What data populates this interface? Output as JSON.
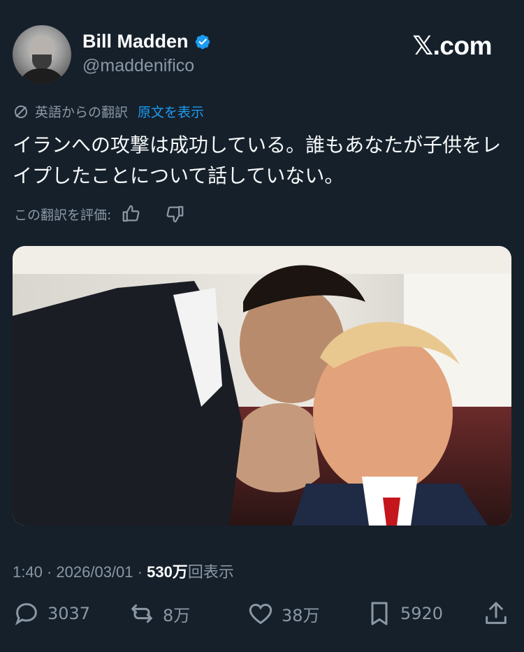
{
  "author": {
    "name": "Bill Madden",
    "handle": "@maddenifico",
    "verified": true,
    "avatar_icon": "profile-photo"
  },
  "brand": {
    "prefix": "𝕏",
    "suffix": ".com"
  },
  "translation": {
    "source_label": "英語からの翻訳",
    "show_original_label": "原文を表示",
    "text": "イランへの攻撃は成功している。誰もあなたが子供をレイプしたことについて話していない。",
    "rate_label": "この翻訳を評価:"
  },
  "media": {
    "alt_icon": "photo"
  },
  "meta": {
    "time": "1:40",
    "separator": "·",
    "date": "2026/03/01",
    "views_count": "530万",
    "views_label": "回表示"
  },
  "actions": {
    "replies": "3037",
    "reposts": "8万",
    "likes": "38万",
    "bookmarks": "5920"
  },
  "colors": {
    "background": "#15202b",
    "text": "#f7f9f9",
    "secondary": "#8b98a5",
    "accent": "#1d9bf0"
  }
}
